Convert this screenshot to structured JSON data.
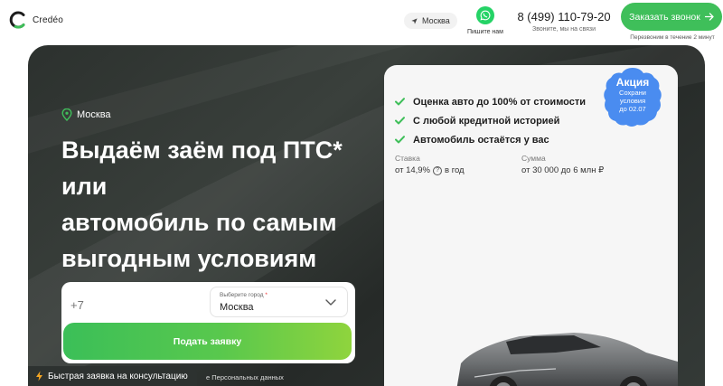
{
  "header": {
    "logo_text": "Credéo",
    "city": "Москва",
    "whatsapp_label": "Пишите нам",
    "phone": "8 (499) 110-79-20",
    "phone_sub": "Звоните, мы на связи",
    "call_button": "Заказать звонок",
    "callback_note": "Перезвоним в течение 2 минут"
  },
  "hero": {
    "city": "Москва",
    "title_lines": [
      "Выдаём заём под ПТС*",
      "или",
      "автомобиль по самым",
      "выгодным условиям"
    ]
  },
  "form": {
    "phone_placeholder": "+7",
    "city_label": "Выберите город",
    "city_required_mark": "*",
    "city_value": "Москва",
    "submit": "Подать заявку",
    "consent_text": "е Персональных данных"
  },
  "consult_badge": "Быстрая заявка на консультацию",
  "offer": {
    "benefits": [
      "Оценка авто до 100% от стоимости",
      "С любой кредитной историей",
      "Автомобиль остаётся у вас"
    ],
    "rate": {
      "label": "Ставка",
      "value": "от 14,9%",
      "suffix": "в год"
    },
    "amount": {
      "label": "Сумма",
      "value": "от 30 000 до 6 млн ₽"
    }
  },
  "promo": {
    "title": "Акция",
    "lines": [
      "Сохрани",
      "условия",
      "до 02.07"
    ]
  },
  "colors": {
    "brand_green": "#3fbf5a",
    "whatsapp": "#25d366",
    "promo_blue": "#4a8cf0",
    "hero_dark": "#2c312e"
  },
  "icons": [
    "logo-c-icon",
    "location-arrow-icon",
    "whatsapp-icon",
    "arrow-right-icon",
    "map-pin-icon",
    "chevron-down-icon",
    "check-icon",
    "info-icon",
    "lightning-icon"
  ]
}
